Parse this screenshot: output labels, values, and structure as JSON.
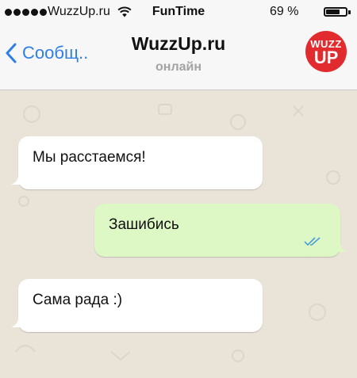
{
  "status_bar": {
    "carrier": "WuzzUp.ru",
    "title": "FunTime",
    "battery_percent": "69 %",
    "battery_level": 0.69
  },
  "nav": {
    "back_label": "Сообщ..",
    "title": "WuzzUp.ru",
    "subtitle": "онлайн",
    "avatar_line1": "WUZZ",
    "avatar_line2": "UP"
  },
  "messages": [
    {
      "direction": "incoming",
      "text": "Мы расстаемся!"
    },
    {
      "direction": "outgoing",
      "text": "Зашибись",
      "status": "read"
    },
    {
      "direction": "incoming",
      "text": "Сама рада :)"
    }
  ],
  "colors": {
    "accent": "#2f7ee9",
    "incoming_bubble": "#ffffff",
    "outgoing_bubble": "#ddf7c5",
    "chat_background": "#e9e3d8",
    "avatar": "#e12b2e",
    "read_ticks": "#4a9fd8"
  }
}
